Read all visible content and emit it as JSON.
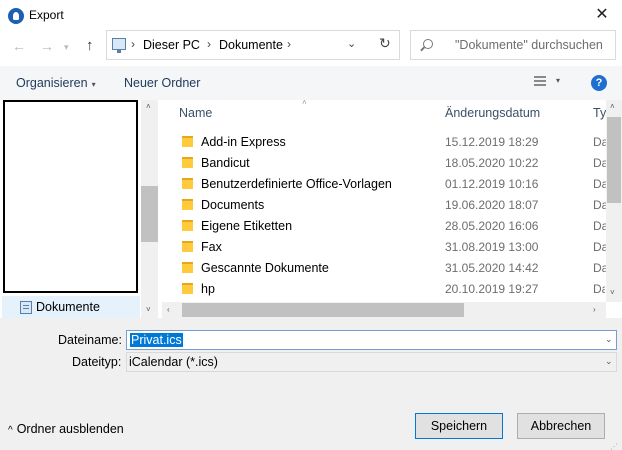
{
  "window": {
    "title": "Export"
  },
  "address": {
    "crumbs": [
      "Dieser PC",
      "Dokumente"
    ],
    "search_placeholder": "\"Dokumente\" durchsuchen"
  },
  "toolbar": {
    "organize_label": "Organisieren",
    "new_folder_label": "Neuer Ordner"
  },
  "nav_pane": {
    "selected_item": "Dokumente"
  },
  "file_list": {
    "columns": {
      "name": "Name",
      "date": "Änderungsdatum",
      "type": "Ty"
    },
    "rows": [
      {
        "name": "Add-in Express",
        "date": "15.12.2019 18:29",
        "type": "Da"
      },
      {
        "name": "Bandicut",
        "date": "18.05.2020 10:22",
        "type": "Da"
      },
      {
        "name": "Benutzerdefinierte Office-Vorlagen",
        "date": "01.12.2019 10:16",
        "type": "Da"
      },
      {
        "name": "Documents",
        "date": "19.06.2020 18:07",
        "type": "Da"
      },
      {
        "name": "Eigene Etiketten",
        "date": "28.05.2020 16:06",
        "type": "Da"
      },
      {
        "name": "Fax",
        "date": "31.08.2019 13:00",
        "type": "Da"
      },
      {
        "name": "Gescannte Dokumente",
        "date": "31.05.2020 14:42",
        "type": "Da"
      },
      {
        "name": "hp",
        "date": "20.10.2019 19:27",
        "type": "Da"
      }
    ]
  },
  "form": {
    "filename_label": "Dateiname:",
    "filename_value": "Privat.ics",
    "filetype_label": "Dateityp:",
    "filetype_value": "iCalendar (*.ics)"
  },
  "footer": {
    "hide_folders_label": "Ordner ausblenden",
    "save_label": "Speichern",
    "cancel_label": "Abbrechen"
  }
}
